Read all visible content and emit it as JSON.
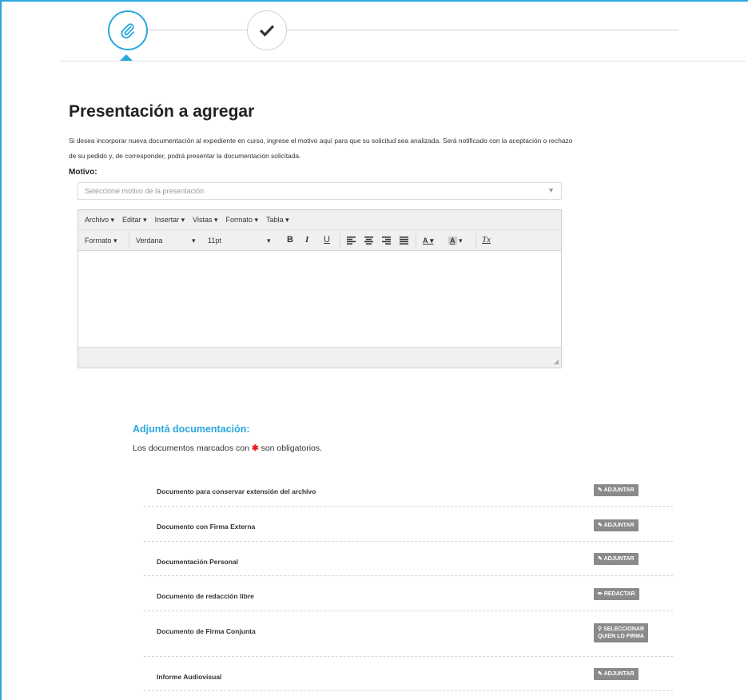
{
  "stepper": {
    "steps": [
      {
        "icon": "paperclip-icon",
        "active": true
      },
      {
        "icon": "check-icon",
        "active": false
      }
    ]
  },
  "title": "Presentación a agregar",
  "description": "Si desea incorporar nueva documentación al expediente en curso, ingrese el motivo aquí para que su solicitud sea analizada. Será notificado con la aceptación o rechazo de su pedido y, de corresponder, podrá presentar la documentación solicitada.",
  "motivo": {
    "label": "Motivo:",
    "placeholder": "Seleccione motivo de la presentación"
  },
  "editor": {
    "menu": [
      "Archivo",
      "Editar",
      "Insertar",
      "Vistas",
      "Formato",
      "Tabla"
    ],
    "format_label": "Formato",
    "font": "Verdana",
    "size": "11pt",
    "bold": "B",
    "italic": "I",
    "underline": "U",
    "clear": "Tx",
    "text_color": "A",
    "bg_color": "A"
  },
  "adjunta": {
    "title": "Adjuntá documentación:",
    "note_before": "Los documentos marcados con",
    "note_star": "✱",
    "note_after": "son obligatorios."
  },
  "documents": [
    {
      "name": "Documento para conservar extensión del archivo",
      "button": "ADJUNTAR",
      "icon": "tag-icon"
    },
    {
      "name": "Documento con Firma Externa",
      "button": "ADJUNTAR",
      "icon": "tag-icon"
    },
    {
      "name": "Documentación Personal",
      "button": "ADJUNTAR",
      "icon": "tag-icon"
    },
    {
      "name": "Documento de redacción libre",
      "button": "REDACTAR",
      "icon": "pencil-icon"
    },
    {
      "name": "Documento de Firma Conjunta",
      "button_line1": "SELECCIONAR",
      "button_line2": "QUIEN LO FIRMA",
      "icon": "search-icon"
    },
    {
      "name": "Informe Audiovisual",
      "button": "ADJUNTAR",
      "icon": "tag-icon"
    }
  ],
  "colors": {
    "accent": "#29a8e0",
    "button": "#8a8a8a",
    "required": "#e21b1b"
  }
}
